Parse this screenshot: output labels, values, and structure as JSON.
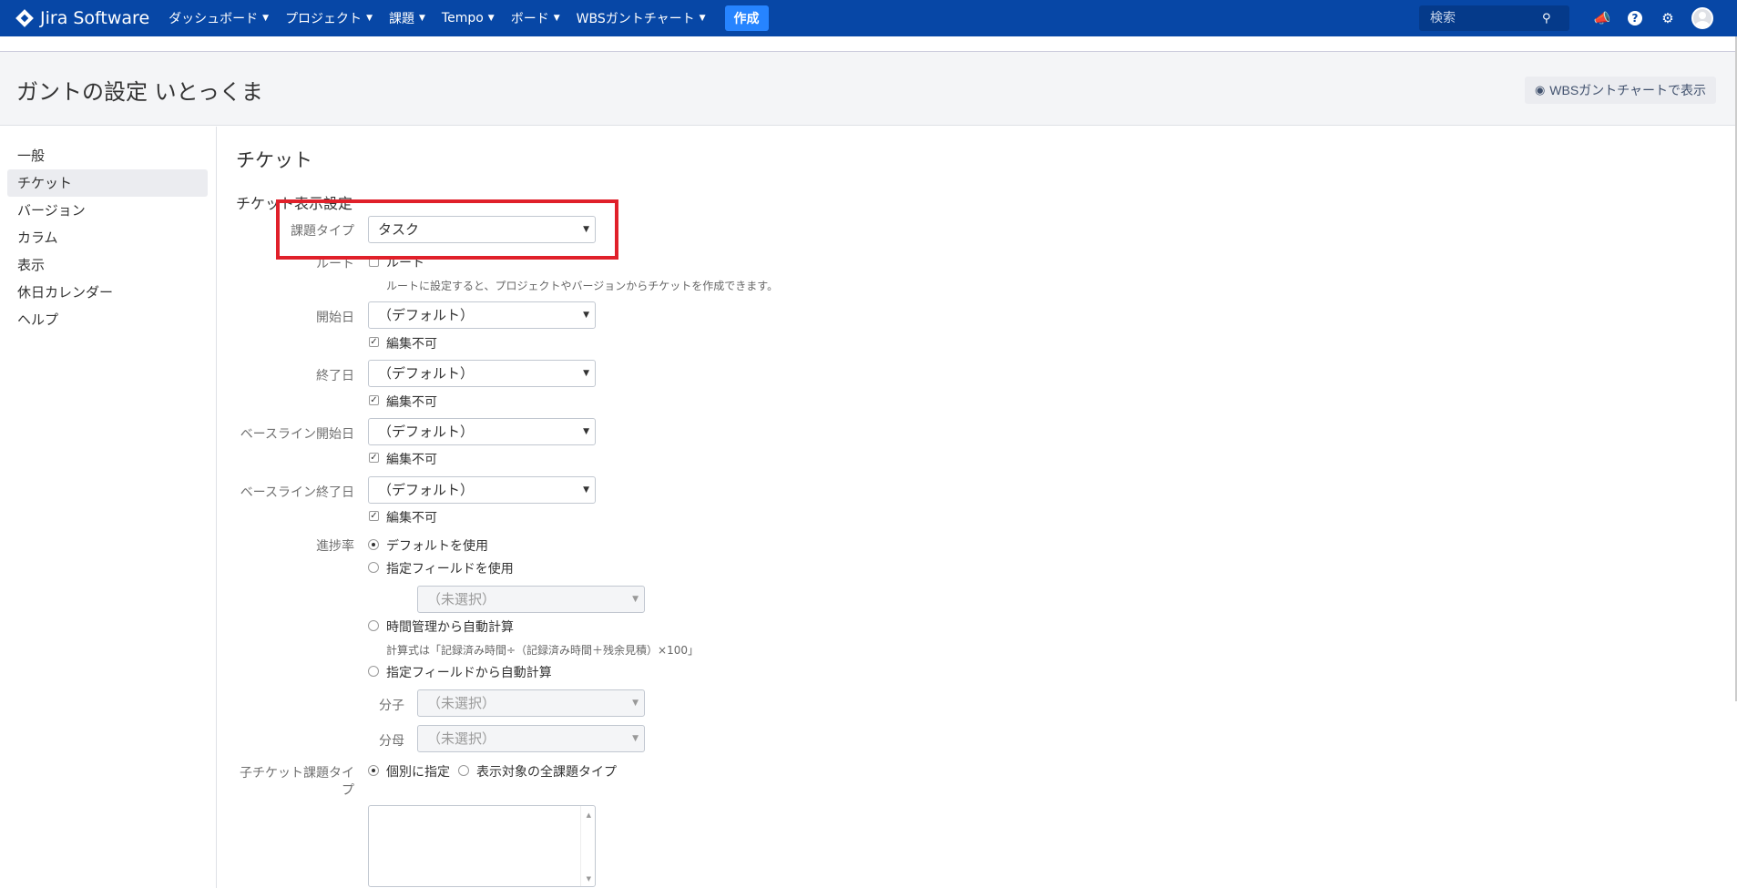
{
  "nav": {
    "logo": "Jira Software",
    "items": [
      "ダッシュボード",
      "プロジェクト",
      "課題",
      "Tempo",
      "ボード",
      "WBSガントチャート"
    ],
    "create": "作成",
    "search_placeholder": "検索",
    "help": "?"
  },
  "header": {
    "title": "ガントの設定 いとっくま",
    "view_button": "WBSガントチャートで表示"
  },
  "sidebar": {
    "items": [
      "一般",
      "チケット",
      "バージョン",
      "カラム",
      "表示",
      "休日カレンダー",
      "ヘルプ"
    ]
  },
  "main": {
    "title": "チケット",
    "section": "チケット表示設定",
    "issue_type": {
      "label": "課題タイプ",
      "value": "タスク"
    },
    "root": {
      "label": "ルート",
      "checkbox": "ルート",
      "hint": "ルートに設定すると、プロジェクトやバージョンからチケットを作成できます。"
    },
    "start_date": {
      "label": "開始日",
      "value": "（デフォルト）",
      "readonly": "編集不可"
    },
    "end_date": {
      "label": "終了日",
      "value": "（デフォルト）",
      "readonly": "編集不可"
    },
    "baseline_start": {
      "label": "ベースライン開始日",
      "value": "（デフォルト）",
      "readonly": "編集不可"
    },
    "baseline_end": {
      "label": "ベースライン終了日",
      "value": "（デフォルト）",
      "readonly": "編集不可"
    },
    "progress": {
      "label": "進捗率",
      "opt_default": "デフォルトを使用",
      "opt_field": "指定フィールドを使用",
      "field_select": "（未選択）",
      "opt_time": "時間管理から自動計算",
      "time_hint": "計算式は「記録済み時間÷（記録済み時間＋残余見積）×100」",
      "opt_field_calc": "指定フィールドから自動計算",
      "numerator_label": "分子",
      "numerator_value": "（未選択）",
      "denominator_label": "分母",
      "denominator_value": "（未選択）"
    },
    "child_type": {
      "label_1": "子チケット課題タイ",
      "label_2": "プ",
      "opt_individual": "個別に指定",
      "opt_all": "表示対象の全課題タイプ"
    }
  }
}
